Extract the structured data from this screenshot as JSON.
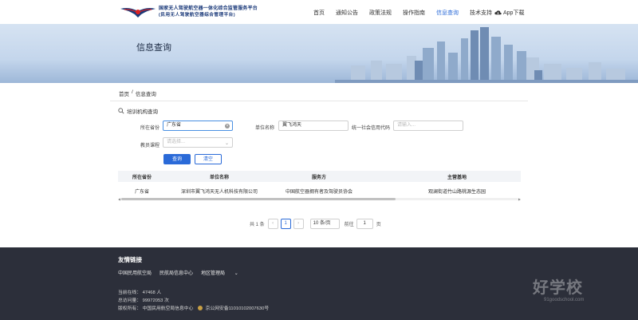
{
  "header": {
    "brand_line1": "国家无人驾驶航空器一体化综合监管服务平台",
    "brand_line2": "(民用无人驾驶航空器综合管理平台)",
    "nav": [
      "首页",
      "通知公告",
      "政策法规",
      "操作指南",
      "信息查询",
      "技术支持"
    ],
    "nav_active_index": 4,
    "app_download": "App下载",
    "accent_color": "#2a6ad8"
  },
  "banner": {
    "title": "信息查询"
  },
  "breadcrumb": {
    "home": "首页",
    "separator": "/",
    "current": "信息查询"
  },
  "query": {
    "section_title": "培训机构查询",
    "province_label": "所在省份",
    "province_value": "广东省",
    "org_label": "单位名称",
    "org_value": "翼飞鸿天",
    "credit_label": "统一社会信用代码",
    "credit_placeholder": "请输入...",
    "course_label": "教员课程",
    "course_placeholder": "请选择...",
    "search_button": "查询",
    "clear_button": "清空"
  },
  "table": {
    "columns": [
      "所在省份",
      "单位名称",
      "服务方",
      "主营基地"
    ],
    "rows": [
      [
        "广东省",
        "深圳市翼飞鸿天无人机科技有限公司",
        "中国航空器拥有者及驾驶员协会",
        "观澜街道竹山路桃源生态园"
      ]
    ]
  },
  "pagination": {
    "total_text": "共 1 条",
    "prev": "‹",
    "current_page": "1",
    "next": "›",
    "page_size": "10 条/页",
    "goto_label": "前往",
    "goto_value": "1",
    "page_unit": "页"
  },
  "footer": {
    "title": "友情链接",
    "links": [
      "中国民用航空局",
      "民航局信息中心",
      "地区管理局"
    ],
    "online": "当前在线： 47468 人",
    "visits": "总访问量： 99972053 次",
    "copyright": "版权所有： 中国民用航空局信息中心",
    "icp": "京公网安备11010102007630号",
    "watermark_brand": "好学校",
    "watermark_url": "91goodschool.com"
  }
}
